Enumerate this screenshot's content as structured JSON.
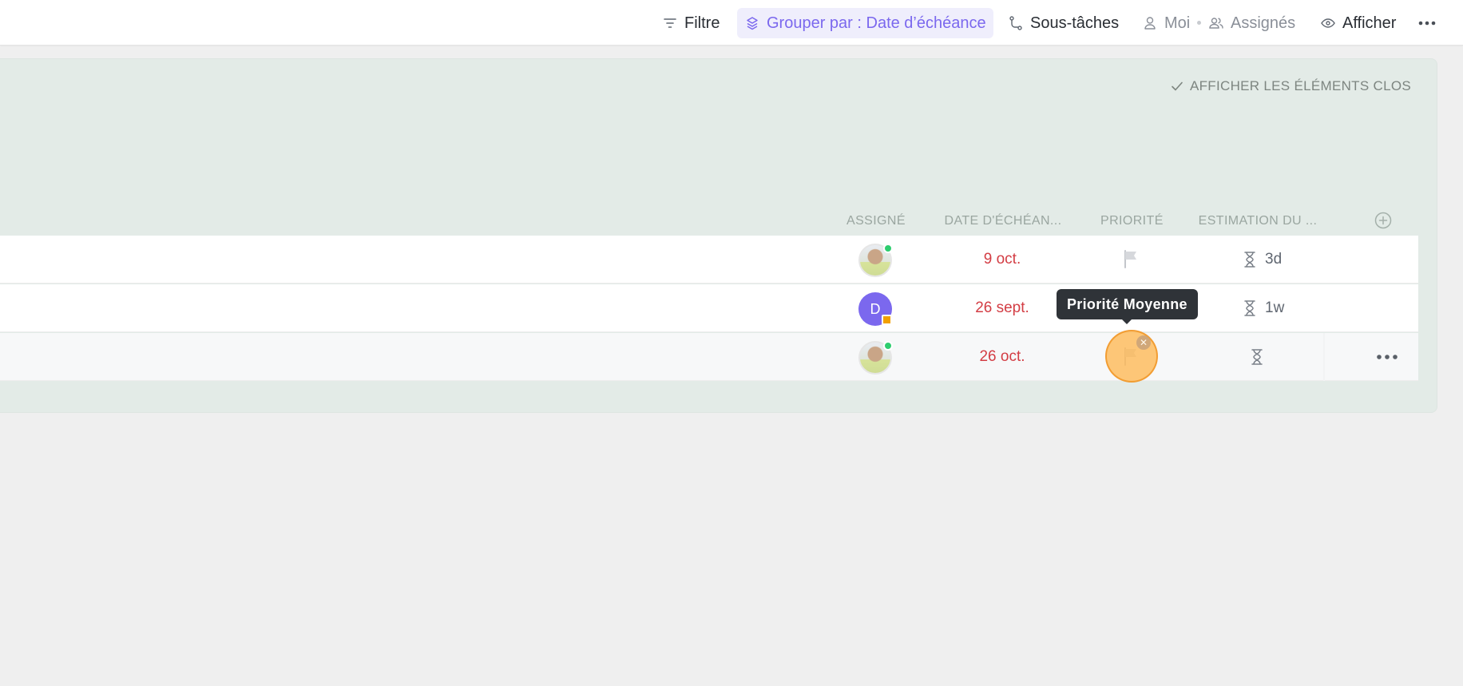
{
  "toolbar": {
    "filter_label": "Filtre",
    "group_label": "Grouper par : Date d’échéance",
    "subtasks_label": "Sous-tâches",
    "me_label": "Moi",
    "assignees_label": "Assignés",
    "show_label": "Afficher",
    "accent_color": "#7b68ee"
  },
  "panel": {
    "show_closed_label": "AFFICHER LES ÉLÉMENTS CLOS",
    "columns": {
      "assignee": "ASSIGNÉ",
      "due_date": "DATE D'ÉCHÉAN...",
      "priority": "PRIORITÉ",
      "estimate": "ESTIMATION DU ..."
    }
  },
  "rows": [
    {
      "assignee_type": "photo",
      "due": "9 oct.",
      "priority": "none",
      "estimate": "3d"
    },
    {
      "assignee_type": "letter",
      "assignee_letter": "D",
      "due": "26 sept.",
      "priority": "none",
      "estimate": "1w"
    },
    {
      "assignee_type": "photo",
      "due": "26 oct.",
      "priority": "none",
      "estimate": ""
    }
  ],
  "tooltip": {
    "text": "Priorité Moyenne"
  },
  "colors": {
    "overdue": "#d33d44",
    "panel_bg": "#e3ebe7",
    "online": "#2ecd6f"
  }
}
